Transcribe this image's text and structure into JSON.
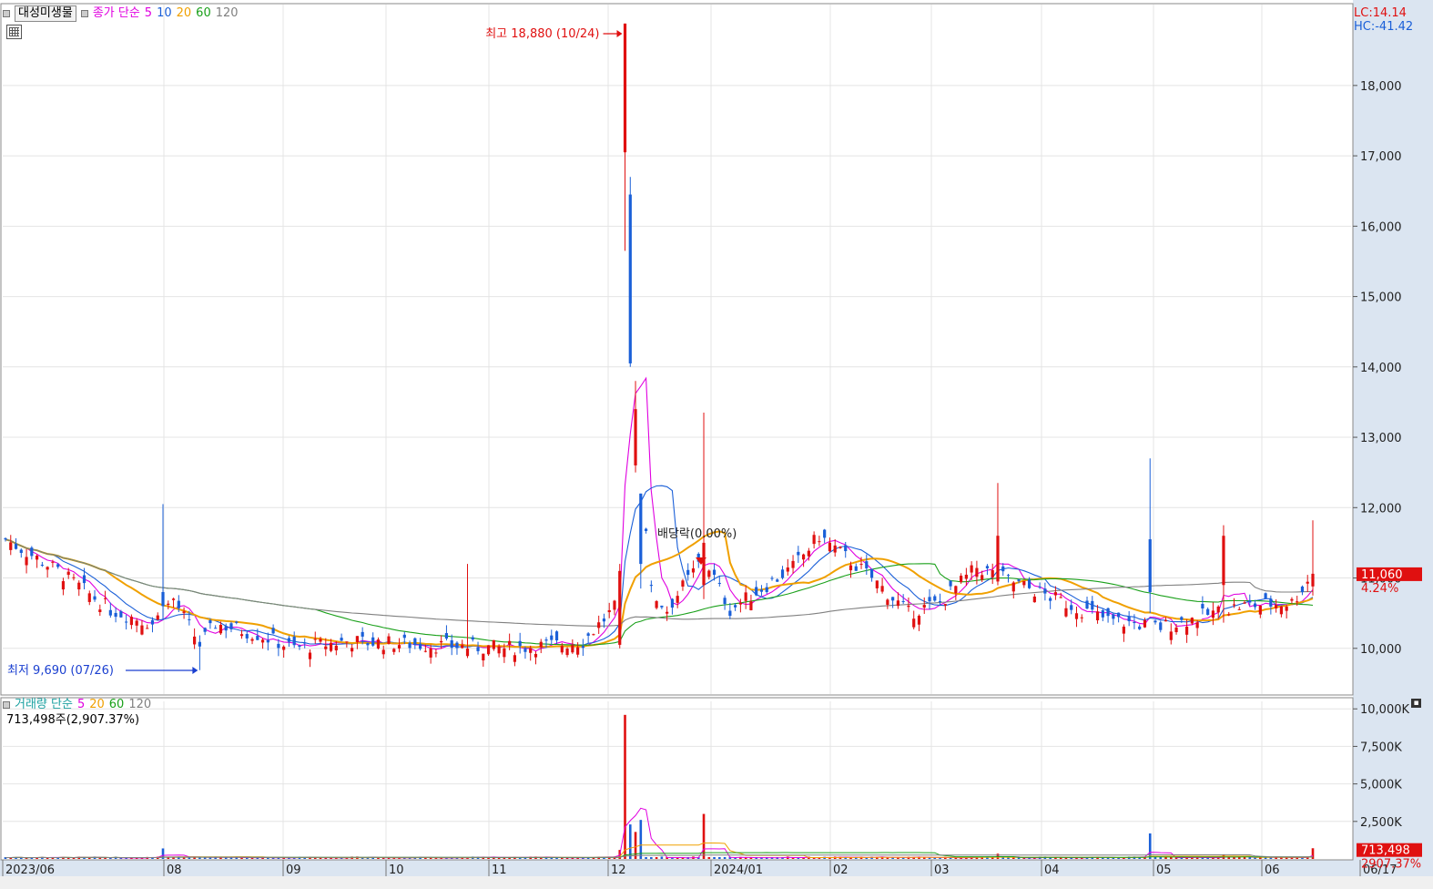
{
  "stock_name": "대성미생물",
  "price_legend": {
    "label": "종가 단순",
    "periods": [
      "5",
      "10",
      "20",
      "60",
      "120"
    ],
    "colors": [
      "#e000e0",
      "#1a5fd8",
      "#f0a000",
      "#1aa01a",
      "#808080"
    ]
  },
  "volume_legend": {
    "label": "거래량 단순",
    "periods": [
      "5",
      "20",
      "60",
      "120"
    ],
    "colors": [
      "#e000e0",
      "#f0a000",
      "#1aa01a",
      "#808080"
    ]
  },
  "lc_label": "LC:14.14",
  "hc_label": "HC:-41.42",
  "annotations": {
    "high": "최고 18,880 (10/24)",
    "low": "최저 9,690 (07/26)",
    "dividend": "배당락(0.00%)"
  },
  "current_price": "11,060",
  "current_change": "4.24%",
  "volume_info": "713,498주(2,907.37%)",
  "current_volume": "713,498",
  "volume_ratio": "2907.37%",
  "colors": {
    "up": "#e01010",
    "down": "#1a5fd8",
    "axis_bg": "#dbe5f1",
    "grid": "#e4e4e4",
    "price_tag": "#e01010"
  },
  "chart_data": {
    "type": "candlestick",
    "price_axis": {
      "ticks": [
        "10,000",
        "11,000",
        "12,000",
        "13,000",
        "14,000",
        "15,000",
        "16,000",
        "17,000",
        "18,000"
      ],
      "ylim": [
        9350,
        19150
      ]
    },
    "volume_axis": {
      "ticks": [
        "2,500K",
        "5,000K",
        "7,500K",
        "10,000K"
      ],
      "ylim": [
        0,
        10500
      ]
    },
    "x_labels": [
      "2023/06",
      "08",
      "09",
      "10",
      "11",
      "12",
      "2024/01",
      "02",
      "03",
      "04",
      "05",
      "06",
      "06/17"
    ],
    "high": {
      "value": 18880,
      "date": "10/24"
    },
    "low": {
      "value": 9690,
      "date": "07/26"
    },
    "last_close": 11060,
    "last_volume_k": 713
  }
}
